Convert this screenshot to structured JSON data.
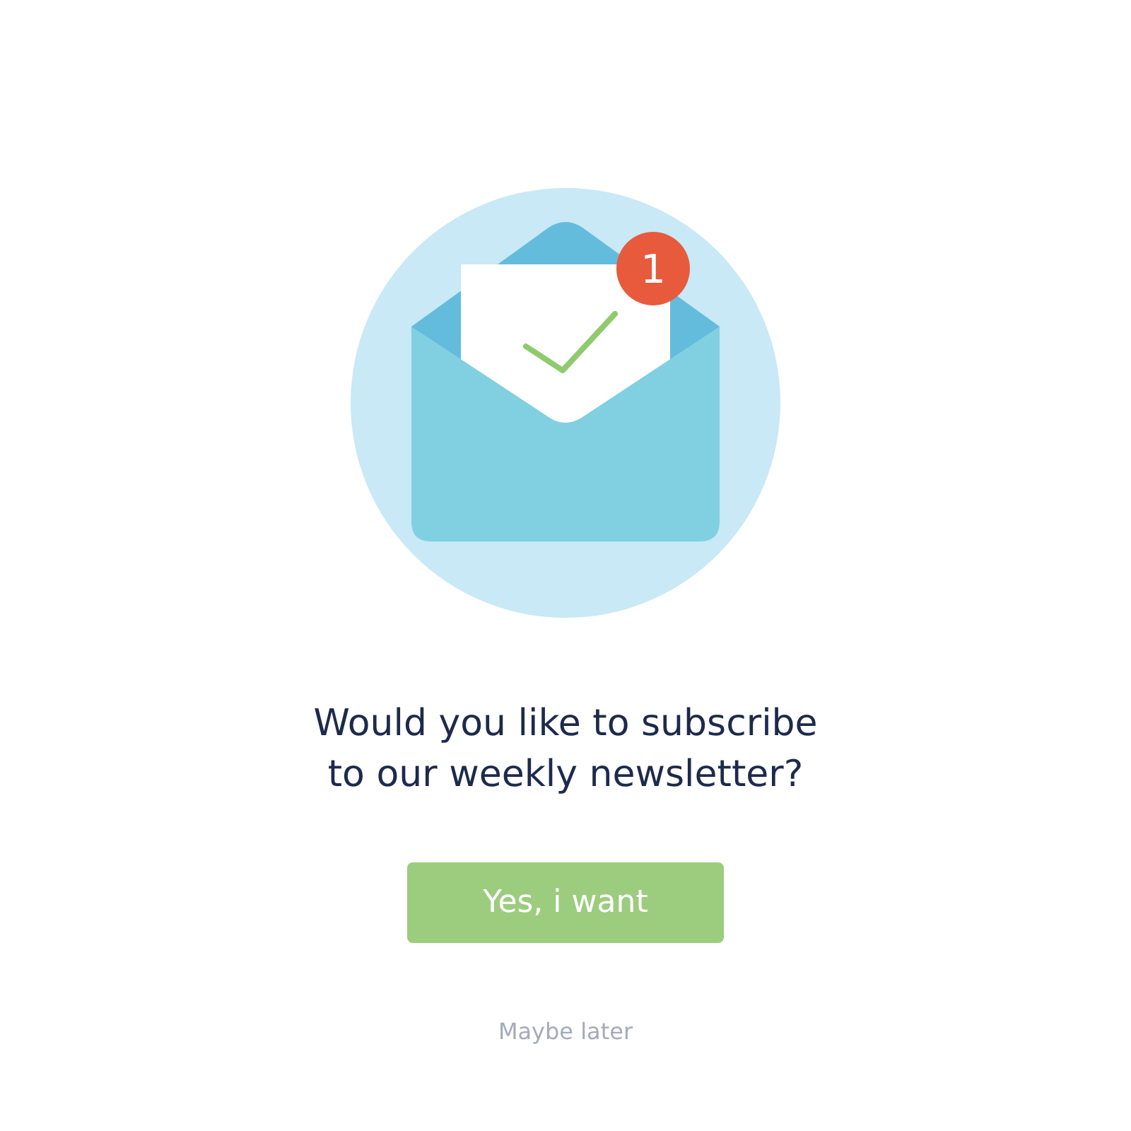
{
  "illustration": {
    "badge": "1"
  },
  "question_lines": [
    "Would you like to subscribe",
    "to our weekly newsletter?"
  ],
  "primary_button": "Yes, i want",
  "secondary_link": "Maybe later"
}
